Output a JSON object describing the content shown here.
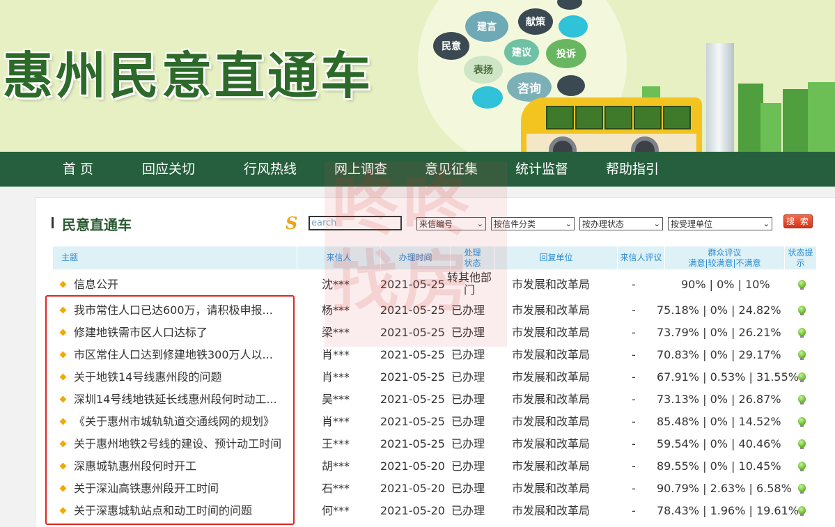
{
  "site": {
    "title": "惠州民意直通车"
  },
  "banner_bubbles": [
    "民意",
    "建言",
    "献策",
    "表扬",
    "建议",
    "投诉",
    "咨询"
  ],
  "nav": {
    "items": [
      "首 页",
      "回应关切",
      "行风热线",
      "网上调查",
      "意见征集",
      "统计监督",
      "帮助指引"
    ]
  },
  "panel": {
    "title": "民意直通车",
    "search_logo": "S",
    "search_placeholder": "earch",
    "filters": [
      "来信编号",
      "按信件分类",
      "按办理状态",
      "按受理单位"
    ],
    "search_button": "搜 索"
  },
  "table": {
    "headers": {
      "subject": "主题",
      "sender": "来信人",
      "date": "办理时间",
      "status_l1": "处理",
      "status_l2": "状态",
      "unit": "回复单位",
      "rating": "来信人评议",
      "public_l1": "群众评议",
      "public_l2": "满意|较满意|不满意",
      "hint_l1": "状态提",
      "hint_l2": "示"
    },
    "rows": [
      {
        "subject": "信息公开",
        "sender": "沈***",
        "date": "2021-05-25",
        "status_l1": "转其他部",
        "status_l2": "门",
        "unit": "市发展和改革局",
        "rating": "-",
        "public": "90% | 0% | 10%",
        "hint": "green-bulb-icon"
      },
      {
        "subject": "我市常住人口已达600万，请积极申报...",
        "sender": "杨***",
        "date": "2021-05-25",
        "status": "已办理",
        "unit": "市发展和改革局",
        "rating": "-",
        "public": "75.18% | 0% | 24.82%",
        "hint": "green-bulb-icon"
      },
      {
        "subject": "修建地铁需市区人口达标了",
        "sender": "梁***",
        "date": "2021-05-25",
        "status": "已办理",
        "unit": "市发展和改革局",
        "rating": "-",
        "public": "73.79% | 0% | 26.21%",
        "hint": "green-bulb-icon"
      },
      {
        "subject": "市区常住人口达到修建地铁300万人以...",
        "sender": "肖***",
        "date": "2021-05-25",
        "status": "已办理",
        "unit": "市发展和改革局",
        "rating": "-",
        "public": "70.83% | 0% | 29.17%",
        "hint": "green-bulb-icon"
      },
      {
        "subject": "关于地铁14号线惠州段的问题",
        "sender": "肖***",
        "date": "2021-05-25",
        "status": "已办理",
        "unit": "市发展和改革局",
        "rating": "-",
        "public": "67.91% | 0.53% | 31.55%",
        "hint": "green-bulb-icon"
      },
      {
        "subject": "深圳14号线地铁延长线惠州段何时动工...",
        "sender": "吴***",
        "date": "2021-05-25",
        "status": "已办理",
        "unit": "市发展和改革局",
        "rating": "-",
        "public": "73.13% | 0% | 26.87%",
        "hint": "green-bulb-icon"
      },
      {
        "subject": "《关于惠州市城轨轨道交通线网的规划》",
        "sender": "肖***",
        "date": "2021-05-25",
        "status": "已办理",
        "unit": "市发展和改革局",
        "rating": "-",
        "public": "85.48% | 0% | 14.52%",
        "hint": "green-bulb-icon"
      },
      {
        "subject": "关于惠州地铁2号线的建设、预计动工时间",
        "sender": "王***",
        "date": "2021-05-25",
        "status": "已办理",
        "unit": "市发展和改革局",
        "rating": "-",
        "public": "59.54% | 0% | 40.46%",
        "hint": "green-bulb-icon"
      },
      {
        "subject": "深惠城轨惠州段何时开工",
        "sender": "胡***",
        "date": "2021-05-20",
        "status": "已办理",
        "unit": "市发展和改革局",
        "rating": "-",
        "public": "89.55% | 0% | 10.45%",
        "hint": "green-bulb-icon"
      },
      {
        "subject": "关于深汕高铁惠州段开工时间",
        "sender": "石***",
        "date": "2021-05-20",
        "status": "已办理",
        "unit": "市发展和改革局",
        "rating": "-",
        "public": "90.79% | 2.63% | 6.58%",
        "hint": "green-bulb-icon"
      },
      {
        "subject": "关于深惠城轨站点和动工时间的问题",
        "sender": "何***",
        "date": "2021-05-20",
        "status": "已办理",
        "unit": "市发展和改革局",
        "rating": "-",
        "public": "78.43% | 1.96% | 19.61%",
        "hint": "green-bulb-icon"
      }
    ]
  },
  "watermark": {
    "line1": "咚咚",
    "line2": "找房"
  },
  "colors": {
    "nav_bg": "#265f3d",
    "banner_bg": "#e6f0c2",
    "header_bg": "#ddf1f7",
    "header_text": "#2b8bd0",
    "highlight": "#e0261d",
    "title_green": "#2d6a2a"
  }
}
